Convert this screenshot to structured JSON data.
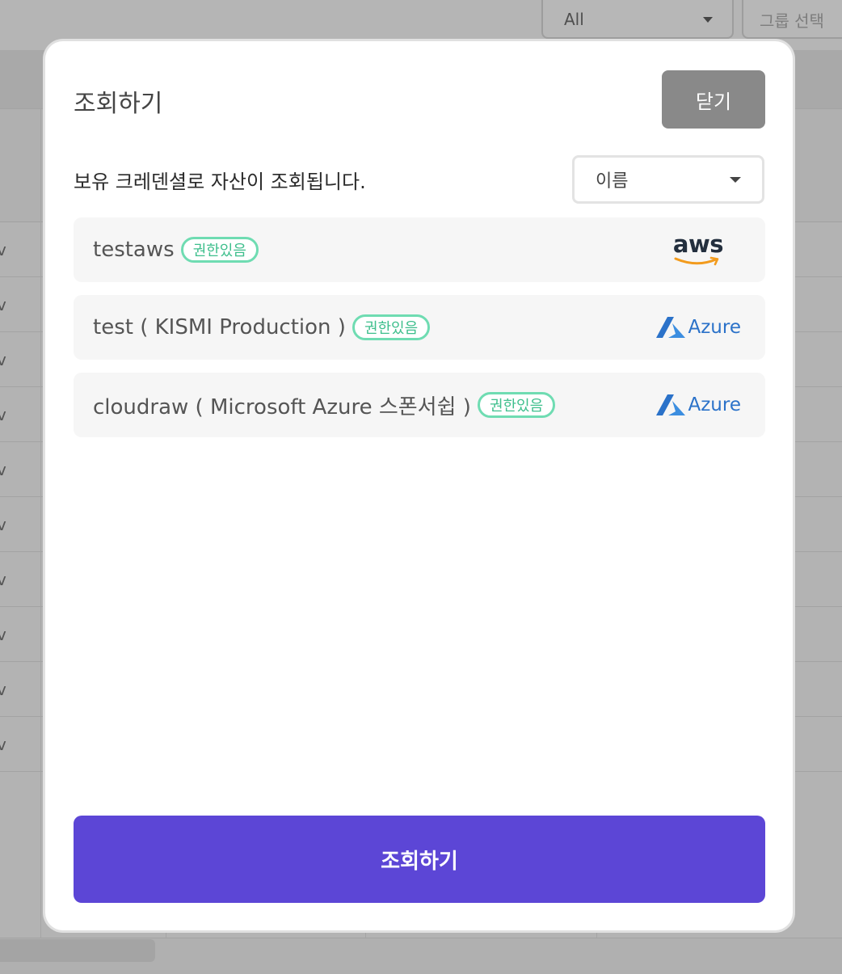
{
  "background": {
    "filter_select_value": "All",
    "group_select_placeholder": "그룹 선택",
    "row_fragment": "v"
  },
  "modal": {
    "title": "조회하기",
    "close_label": "닫기",
    "subtitle": "보유 크레덴셜로 자산이 조회됩니다.",
    "sort_select_value": "이름",
    "credentials": [
      {
        "name": "testaws",
        "badge": "권한있음",
        "provider": "aws",
        "provider_label": "aws"
      },
      {
        "name": "test ( KISMI Production )",
        "badge": "권한있음",
        "provider": "azure",
        "provider_label": "Azure"
      },
      {
        "name": "cloudraw ( Microsoft Azure 스폰서쉽 )",
        "badge": "권한있음",
        "provider": "azure",
        "provider_label": "Azure"
      }
    ],
    "submit_label": "조회하기"
  },
  "colors": {
    "primary": "#5c46d6",
    "close_button": "#898989",
    "badge_border": "#6fdcb2",
    "badge_text": "#3fbf8d",
    "azure_blue": "#2b72c9",
    "aws_orange": "#f29b1d"
  }
}
